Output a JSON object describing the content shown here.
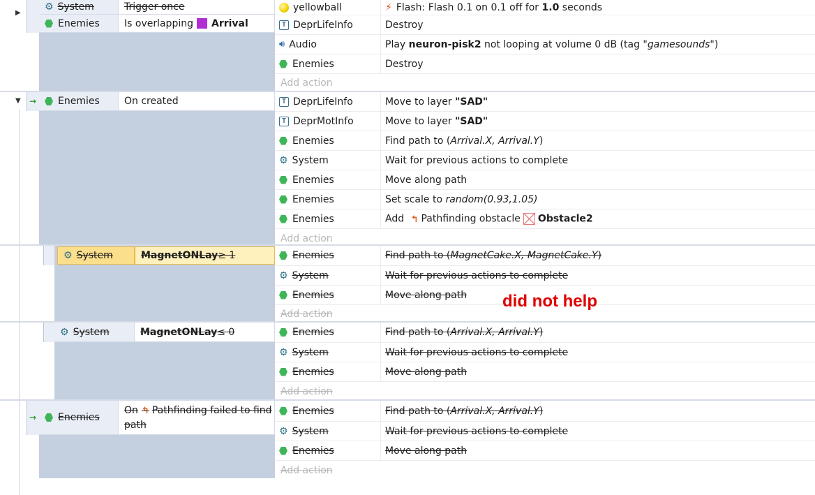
{
  "colors": {
    "condition_bg": "#c4cfe0",
    "selected": "#fbdf8c",
    "note": "#e00000",
    "trigger_arrow": "#2e9a2e"
  },
  "events": [
    {
      "conditions": [
        {
          "object": "System",
          "icon": "gear-icon",
          "text": "Trigger once",
          "disabled": true
        },
        {
          "object": "Enemies",
          "icon": "sprite-icon",
          "text": "Is overlapping",
          "target": "Arrival"
        }
      ],
      "actions": [
        {
          "object": "yellowball",
          "icon": "ball-icon",
          "prefix": "Flash: Flash 0.1 on 0.1 off for ",
          "bold": "1.0",
          "suffix": " seconds"
        },
        {
          "object": "DeprLifeInfo",
          "icon": "text-icon",
          "text": "Destroy"
        },
        {
          "object": "Audio",
          "icon": "speaker-icon",
          "prefix": "Play ",
          "bold": "neuron-pisk2",
          "mid": " not looping at volume 0 dB (tag \"",
          "italic": "gamesounds",
          "suffix": "\")"
        },
        {
          "object": "Enemies",
          "icon": "sprite-icon",
          "text": "Destroy"
        }
      ],
      "add_action": "Add action"
    },
    {
      "conditions": [
        {
          "object": "Enemies",
          "icon": "sprite-icon",
          "text": "On created"
        }
      ],
      "actions": [
        {
          "object": "DeprLifeInfo",
          "icon": "text-icon",
          "prefix": "Move to layer ",
          "bold": "\"SAD\""
        },
        {
          "object": "DeprMotInfo",
          "icon": "text-icon",
          "prefix": "Move to layer ",
          "bold": "\"SAD\""
        },
        {
          "object": "Enemies",
          "icon": "sprite-icon",
          "prefix": "Find path to (",
          "italic": "Arrival.X, Arrival.Y",
          "suffix": ")"
        },
        {
          "object": "System",
          "icon": "gear-icon",
          "text": "Wait for previous actions to complete"
        },
        {
          "object": "Enemies",
          "icon": "sprite-icon",
          "text": "Move along path"
        },
        {
          "object": "Enemies",
          "icon": "sprite-icon",
          "prefix": "Set scale to ",
          "italic": "random(0.93,1.05)"
        },
        {
          "object": "Enemies",
          "icon": "sprite-icon",
          "prefix": "Add ",
          "mid": "Pathfinding obstacle",
          "bold": "Obstacle2"
        }
      ],
      "add_action": "Add action"
    },
    {
      "conditions": [
        {
          "object": "System",
          "icon": "gear-icon",
          "text": "MagnetONLay",
          "op": " ≥ 1",
          "disabled": true
        }
      ],
      "actions": [
        {
          "object": "Enemies",
          "icon": "sprite-icon",
          "prefix": "Find path to (",
          "italic": "MagnetCake.X, MagnetCake.Y",
          "suffix": ")",
          "disabled": true
        },
        {
          "object": "System",
          "icon": "gear-icon",
          "text": "Wait for previous actions to complete",
          "disabled": true
        },
        {
          "object": "Enemies",
          "icon": "sprite-icon",
          "text": "Move along path",
          "disabled": true
        }
      ],
      "add_action": "Add action"
    },
    {
      "conditions": [
        {
          "object": "System",
          "icon": "gear-icon",
          "text": "MagnetONLay",
          "op": " ≤ 0",
          "disabled": true
        }
      ],
      "actions": [
        {
          "object": "Enemies",
          "icon": "sprite-icon",
          "prefix": "Find path to (",
          "italic": "Arrival.X, Arrival.Y",
          "suffix": ")",
          "disabled": true
        },
        {
          "object": "System",
          "icon": "gear-icon",
          "text": "Wait for previous actions to complete",
          "disabled": true
        },
        {
          "object": "Enemies",
          "icon": "sprite-icon",
          "text": "Move along path",
          "disabled": true
        }
      ],
      "add_action": "Add action"
    },
    {
      "conditions": [
        {
          "object": "Enemies",
          "icon": "sprite-icon",
          "prefix": "On",
          "text": "Pathfinding failed to find",
          "text2": "path",
          "disabled": true
        }
      ],
      "actions": [
        {
          "object": "Enemies",
          "icon": "sprite-icon",
          "prefix": "Find path to (",
          "italic": "Arrival.X, Arrival.Y",
          "suffix": ")",
          "disabled": true
        },
        {
          "object": "System",
          "icon": "gear-icon",
          "text": "Wait for previous actions to complete",
          "disabled": true
        },
        {
          "object": "Enemies",
          "icon": "sprite-icon",
          "text": "Move along path",
          "disabled": true
        }
      ],
      "add_action": "Add action"
    }
  ],
  "annotation": "did not help"
}
